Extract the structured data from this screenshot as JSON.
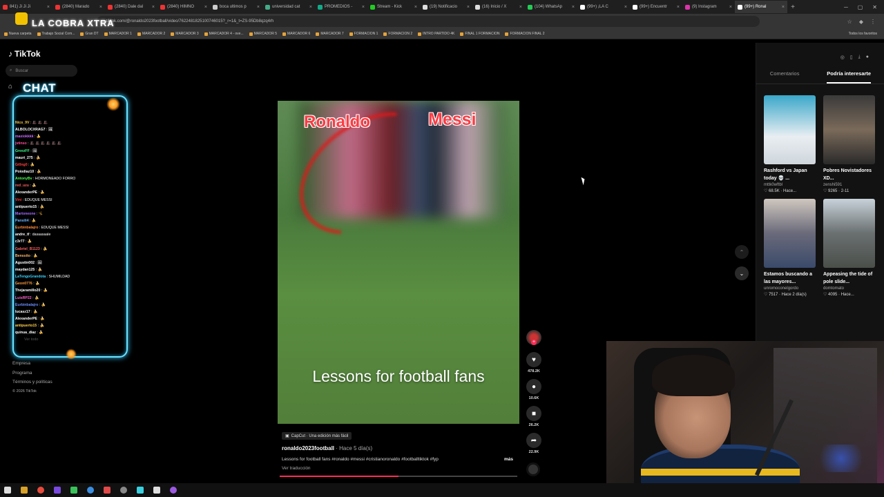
{
  "browser": {
    "tabs": [
      {
        "label": "841) Ji Ji Ji",
        "color": "#e33"
      },
      {
        "label": "(2840) Marado",
        "color": "#e33"
      },
      {
        "label": "(2840) Dale dal",
        "color": "#e33"
      },
      {
        "label": "(2840) HIMNO",
        "color": "#e33"
      },
      {
        "label": "boca ultimos p",
        "color": "#ccc"
      },
      {
        "label": "universidad cat",
        "color": "#4a8"
      },
      {
        "label": "PROMEDIOS -",
        "color": "#1a8"
      },
      {
        "label": "Stream - Kick",
        "color": "#2c2"
      },
      {
        "label": "(19) Notificacio",
        "color": "#ddd"
      },
      {
        "label": "(16) Inicio / X",
        "color": "#ddd"
      },
      {
        "label": "(104) WhatsAp",
        "color": "#2c5"
      },
      {
        "label": "(99+) ¡LA C",
        "color": "#fff"
      },
      {
        "label": "(99+) Encuentr",
        "color": "#fff"
      },
      {
        "label": "(9) Instagram",
        "color": "#d3a"
      },
      {
        "label": "(99+) Ronal",
        "color": "#fff",
        "active": true
      }
    ],
    "url": "tiktok.com/@ronaldo2023football/video/7622481825100746015?_r=1&_t=ZS-95Db8qzq4rh",
    "bookmarks": [
      "Nueva carpeta",
      "Trabajo Social Com...",
      "Gran DT",
      "MARCADOR 1",
      "MARCADOR 2",
      "MARCADOR 3",
      "MARCADOR 4 - ove...",
      "MARCADOR 5",
      "MARCADOR 6",
      "MARCADOR 7",
      "FORMACION 1",
      "FORMACION 2",
      "INTRO PARTIDO 4K",
      "FINAL 1 FORMACION",
      "FORMACION FINAL 2"
    ],
    "bookmarks_right": "Todos los favoritos"
  },
  "overlay": {
    "streamer_title": "LA COBRA XTRA",
    "chat_label": "CHAT",
    "chat_more": "Ver todo",
    "chat": [
      {
        "user": "Nico_9V",
        "msg": ": 🎩 🎩 🎩",
        "color": "#f5c84a"
      },
      {
        "user": "ALBOLOCXRAG7",
        "msg": ": 🖼",
        "color": "#fff"
      },
      {
        "user": "maxiokkkk",
        "msg": ": 🍌",
        "color": "#c96bff"
      },
      {
        "user": "jvtinso",
        "msg": ": 🎩 🎩 🎩 🎩 🎩 🎩",
        "color": "#ff4d9a"
      },
      {
        "user": "GreezFF",
        "msg": ": 🖼",
        "color": "#3cff8a"
      },
      {
        "user": "mauri_275",
        "msg": ": 🍌",
        "color": "#fff"
      },
      {
        "user": "Gi0ng0",
        "msg": ": 🍌",
        "color": "#ff4040"
      },
      {
        "user": "Poiodiaz10",
        "msg": ": 🍌",
        "color": "#fff"
      },
      {
        "user": "AntonyBv",
        "msg": ": HORMONEADO FORRO",
        "color": "#4dff4d"
      },
      {
        "user": "red_uzu",
        "msg": ": 🍌",
        "color": "#ff6060"
      },
      {
        "user": "AlexanderPE",
        "msg": ": 🍌",
        "color": "#fff"
      },
      {
        "user": "Vini",
        "msg": ": EDUQUE MESSI",
        "color": "#ff3030"
      },
      {
        "user": "antipuerto15",
        "msg": ": 🍌",
        "color": "#fff"
      },
      {
        "user": "Martoneone",
        "msg": ": 🤸",
        "color": "#a46bff"
      },
      {
        "user": "Pansili4",
        "msg": ": 🍌",
        "color": "#6bb5ff"
      },
      {
        "user": "Eurbinbalajro",
        "msg": ": EDUQUE MESSI",
        "color": "#ff8a3d"
      },
      {
        "user": "andre_tf",
        "msg": ": dasaasaale",
        "color": "#fff"
      },
      {
        "user": "c3r77",
        "msg": ": 🍌",
        "color": "#fff"
      },
      {
        "user": "Gabriel_B1123",
        "msg": ": 🍌",
        "color": "#ff6060"
      },
      {
        "user": "Benssito",
        "msg": ": 🍌",
        "color": "#ffb86b"
      },
      {
        "user": "Agustin002",
        "msg": ": 🖼",
        "color": "#fff"
      },
      {
        "user": "maydan125",
        "msg": ": 🍌",
        "color": "#fff"
      },
      {
        "user": "LaTengoGrandota",
        "msg": ": SHUMILDAD",
        "color": "#3cd3ff"
      },
      {
        "user": "Geon0776",
        "msg": ": 🍌",
        "color": "#ff9a3d"
      },
      {
        "user": "Thejaramillo20",
        "msg": ": 🍌",
        "color": "#fff"
      },
      {
        "user": "LuisRP22",
        "msg": ": 🍌",
        "color": "#ff5fd0"
      },
      {
        "user": "Eurbinbalajro",
        "msg": ": 🍌",
        "color": "#6b8cff"
      },
      {
        "user": "lucasz17",
        "msg": ": 🍌",
        "color": "#fff"
      },
      {
        "user": "AlexanderPE",
        "msg": ": 🍌",
        "color": "#fff"
      },
      {
        "user": "antipuerto15",
        "msg": ": 🍌",
        "color": "#ffd04d"
      },
      {
        "user": "quinua_diaz",
        "msg": ": 🍌",
        "color": "#fff"
      }
    ]
  },
  "tiktok": {
    "logo": "TikTok",
    "search_placeholder": "Buscar",
    "footer": [
      "Empresa",
      "Programa",
      "Términos y políticas",
      "© 2026 TikTok"
    ],
    "video": {
      "label_left": "Ronaldo",
      "label_right": "Messi",
      "caption": "Lessons for football fans",
      "capcut_badge": "CapCut · Una edición más fácil",
      "author": "ronaldo2023football",
      "posted": " · Hace 5 día(s)",
      "description": "Lessons for football fans #ronaldo #messi #cristianoronaldo #footballtiktok #fyp",
      "more": "más",
      "translate": "Ver traducción",
      "progress": 0.5
    },
    "actions": [
      {
        "name": "like",
        "icon": "♥",
        "count": "478.2K"
      },
      {
        "name": "comment",
        "icon": "●",
        "count": "10.6K"
      },
      {
        "name": "save",
        "icon": "■",
        "count": "26.2K"
      },
      {
        "name": "share",
        "icon": "➦",
        "count": "22.9K"
      }
    ],
    "right_panel": {
      "tabs": [
        "Comentarios",
        "Podría interesarte"
      ],
      "selected_tab": 1,
      "cards": [
        {
          "title": "Rashford vs Japan today 💀 ...",
          "user": "mttk0wftbl",
          "stats": "♡ 68.5K · Hace...",
          "bg": "linear-gradient(180deg,#3aa7c9,#e9eef2 60%,#cfd6dc)"
        },
        {
          "title": "Pobres Novistadores XD...",
          "user": "zenshi591",
          "stats": "♡ 9265 · 2-11",
          "bg": "linear-gradient(180deg,#3a3a3a,#7a6a5a 50%,#2a2a2a)"
        },
        {
          "title": "Estamos buscando a las mayores...",
          "user": "unromoconelgordo",
          "stats": "♡ 7517 · Hace 2 día(s)",
          "bg": "linear-gradient(180deg,#cfc7bf,#6a6a7a 50%,#3a4a6a)"
        },
        {
          "title": "Appeasing the tide of pole slide...",
          "user": "domtomato",
          "stats": "♡ 4095 · Hace...",
          "bg": "linear-gradient(180deg,#c8d2da,#6a7070 50%,#4a4f4a)"
        }
      ]
    }
  }
}
